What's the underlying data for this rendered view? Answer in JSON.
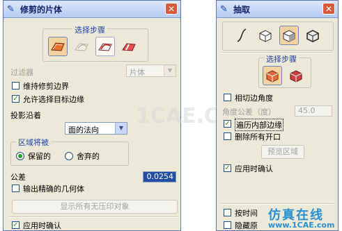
{
  "left_dialog": {
    "title": "修剪的片体",
    "selection_steps_label": "选择步骤",
    "filter_label": "过滤器",
    "filter_value": "片体",
    "keep_trim_boundary": "维持修剪边界",
    "keep_trim_boundary_checked": false,
    "allow_select_target_edge": "允许选择目标边缘",
    "allow_select_target_edge_checked": true,
    "projection_label": "投影沿着",
    "projection_value": "面的法向",
    "region_label": "区域将被",
    "keep_option": "保留的",
    "discard_option": "舍弃的",
    "region_selected": "保留的",
    "tolerance_label": "公差",
    "tolerance_value": "0.0254",
    "output_exact_geometry": "输出精确的几何体",
    "output_exact_geometry_checked": false,
    "show_uncompressed_button": "显示所有无压印对象",
    "confirm_on_apply": "应用时确认",
    "confirm_on_apply_checked": true
  },
  "right_dialog": {
    "title": "抽取",
    "selection_steps_label": "选择步骤",
    "tangent_edge_angle": "相切边角度",
    "tangent_edge_angle_checked": false,
    "angle_tolerance_label": "角度公差（度）",
    "angle_tolerance_value": "45.0",
    "traverse_inner_edges": "遍历内部边缘",
    "traverse_inner_edges_checked": true,
    "remove_all_openings": "删除所有开口",
    "remove_all_openings_checked": false,
    "preview_region_button": "预览区域",
    "confirm_on_apply": "应用时确认",
    "confirm_on_apply_checked": true,
    "by_time_label": "按时间",
    "by_time_checked": false,
    "hide_original_label": "隐藏原",
    "hide_original_checked": false
  },
  "watermarks": {
    "center": "1CAE.CO",
    "brand": "仿真在线",
    "url": "www.1CAE.com"
  },
  "icons": [
    "nx-logo-icon",
    "close-icon",
    "trim-sheet-target-icon",
    "trim-tool-icon",
    "trim-boundary-icon",
    "trim-region-icon",
    "curve-icon",
    "extract-face-icon",
    "extract-region-icon",
    "extract-body-icon",
    "seed-face-icon",
    "boundary-face-icon",
    "dropdown-arrow-icon"
  ]
}
